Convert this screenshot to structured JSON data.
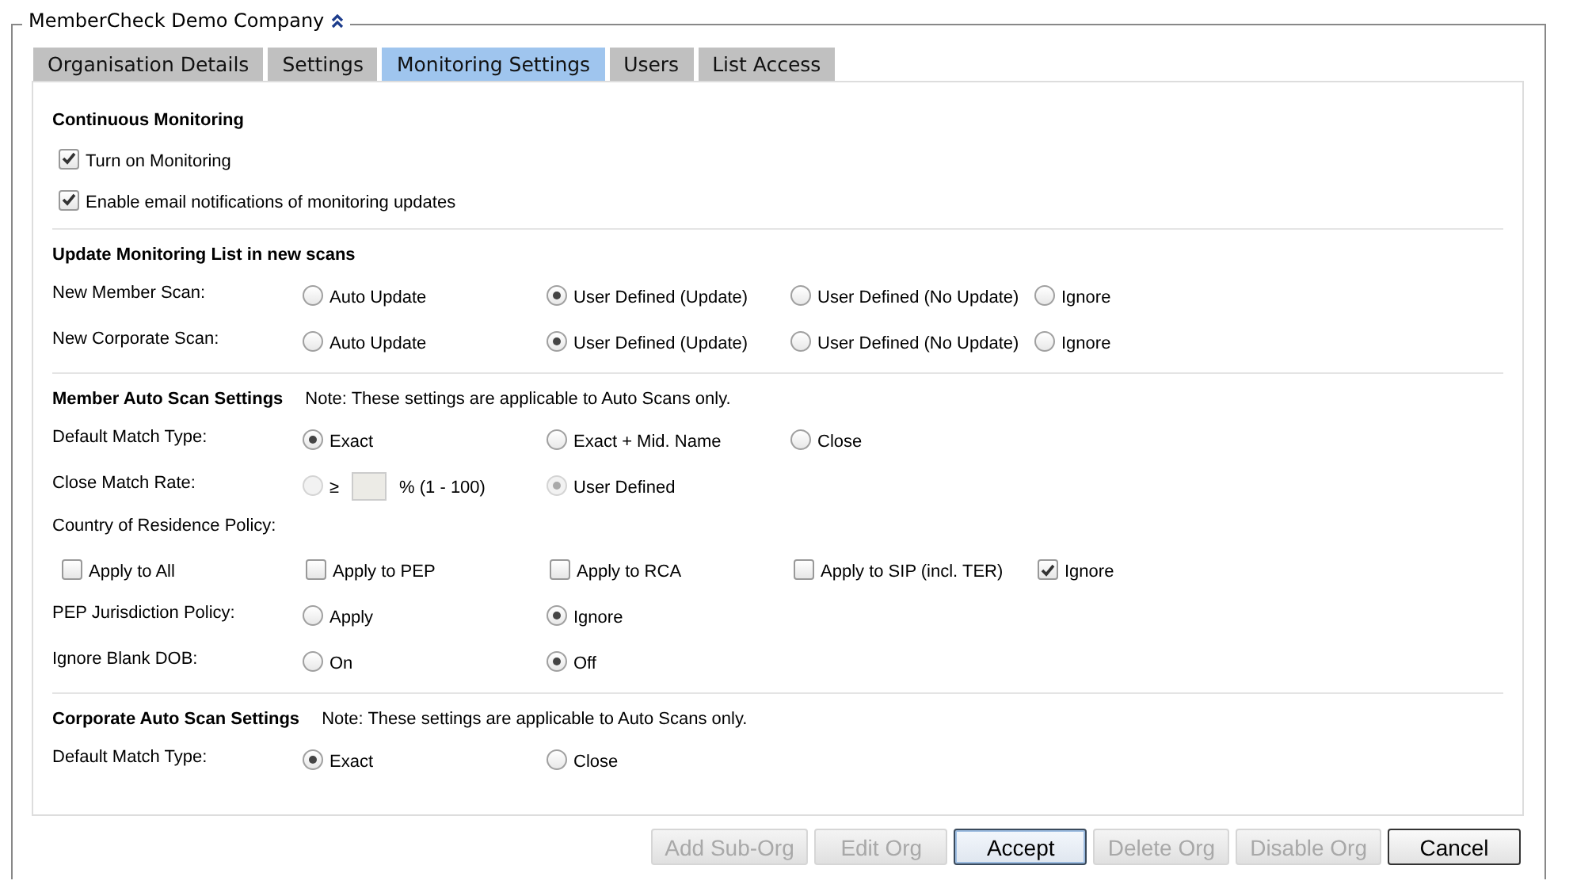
{
  "group": {
    "title": "MemberCheck Demo Company"
  },
  "tabs": [
    {
      "label": "Organisation Details",
      "selected": false
    },
    {
      "label": "Settings",
      "selected": false
    },
    {
      "label": "Monitoring Settings",
      "selected": true
    },
    {
      "label": "Users",
      "selected": false
    },
    {
      "label": "List Access",
      "selected": false
    }
  ],
  "sections": [
    {
      "title": "Continuous Monitoring",
      "rows": [
        {
          "kind": "checkbox",
          "label": "Turn on Monitoring",
          "checked": true
        },
        {
          "kind": "checkbox",
          "label": "Enable email notifications of monitoring updates",
          "checked": true
        }
      ]
    },
    {
      "title": "Update Monitoring List in new scans",
      "rows": [
        {
          "kind": "radios",
          "label": "New Member Scan:",
          "options": [
            {
              "kind": "radio",
              "label": "Auto Update",
              "selected": false,
              "disabled": false
            },
            {
              "kind": "radio",
              "label": "User Defined (Update)",
              "selected": true,
              "disabled": false
            },
            {
              "kind": "radio",
              "label": "User Defined (No Update)",
              "selected": false,
              "disabled": false
            },
            {
              "kind": "radio",
              "label": "Ignore",
              "selected": false,
              "disabled": false
            }
          ]
        },
        {
          "kind": "radios",
          "label": "New Corporate Scan:",
          "options": [
            {
              "kind": "radio",
              "label": "Auto Update",
              "selected": false,
              "disabled": false
            },
            {
              "kind": "radio",
              "label": "User Defined (Update)",
              "selected": true,
              "disabled": false
            },
            {
              "kind": "radio",
              "label": "User Defined (No Update)",
              "selected": false,
              "disabled": false
            },
            {
              "kind": "radio",
              "label": "Ignore",
              "selected": false,
              "disabled": false
            }
          ]
        }
      ]
    },
    {
      "title": "Member Auto Scan Settings",
      "note": "Note: These settings are applicable to Auto Scans only.",
      "rows": [
        {
          "kind": "radios",
          "label": "Default Match Type:",
          "options": [
            {
              "kind": "radio",
              "label": "Exact",
              "selected": true,
              "disabled": false
            },
            {
              "kind": "radio",
              "label": "Exact + Mid. Name",
              "selected": false,
              "disabled": false
            },
            {
              "kind": "radio",
              "label": "Close",
              "selected": false,
              "disabled": false
            }
          ]
        },
        {
          "kind": "radios",
          "label": "Close Match Rate:",
          "options": [
            {
              "kind": "rate",
              "symbol": "≥",
              "unit": "% (1 - 100)",
              "selected": false,
              "disabled": true
            },
            {
              "kind": "radio",
              "label": "User Defined",
              "selected": true,
              "disabled": true
            }
          ]
        },
        {
          "kind": "heading",
          "label": "Country of Residence Policy:"
        },
        {
          "kind": "checkboxes",
          "options": [
            {
              "label": "Apply to All",
              "checked": false
            },
            {
              "label": "Apply to PEP",
              "checked": false
            },
            {
              "label": "Apply to RCA",
              "checked": false
            },
            {
              "label": "Apply to SIP (incl. TER)",
              "checked": false
            },
            {
              "label": "Ignore",
              "checked": true
            }
          ]
        },
        {
          "kind": "radios",
          "label": "PEP Jurisdiction Policy:",
          "options": [
            {
              "kind": "radio",
              "label": "Apply",
              "selected": false,
              "disabled": false
            },
            {
              "kind": "radio",
              "label": "Ignore",
              "selected": true,
              "disabled": false
            }
          ]
        },
        {
          "kind": "radios",
          "label": "Ignore Blank DOB:",
          "options": [
            {
              "kind": "radio",
              "label": "On",
              "selected": false,
              "disabled": false
            },
            {
              "kind": "radio",
              "label": "Off",
              "selected": true,
              "disabled": false
            }
          ]
        }
      ]
    },
    {
      "title": "Corporate Auto Scan Settings",
      "note": "Note: These settings are applicable to Auto Scans only.",
      "rows": [
        {
          "kind": "radios",
          "label": "Default Match Type:",
          "options": [
            {
              "kind": "radio",
              "label": "Exact",
              "selected": true,
              "disabled": false
            },
            {
              "kind": "radio",
              "label": "Close",
              "selected": false,
              "disabled": false
            }
          ]
        }
      ]
    }
  ],
  "buttons": [
    {
      "label": "Add Sub-Org",
      "disabled": true,
      "focused": false
    },
    {
      "label": "Edit Org",
      "disabled": true,
      "focused": false
    },
    {
      "label": "Accept",
      "disabled": false,
      "focused": true
    },
    {
      "label": "Delete Org",
      "disabled": true,
      "focused": false
    },
    {
      "label": "Disable Org",
      "disabled": true,
      "focused": false
    },
    {
      "label": "Cancel",
      "disabled": false,
      "focused": false
    }
  ]
}
